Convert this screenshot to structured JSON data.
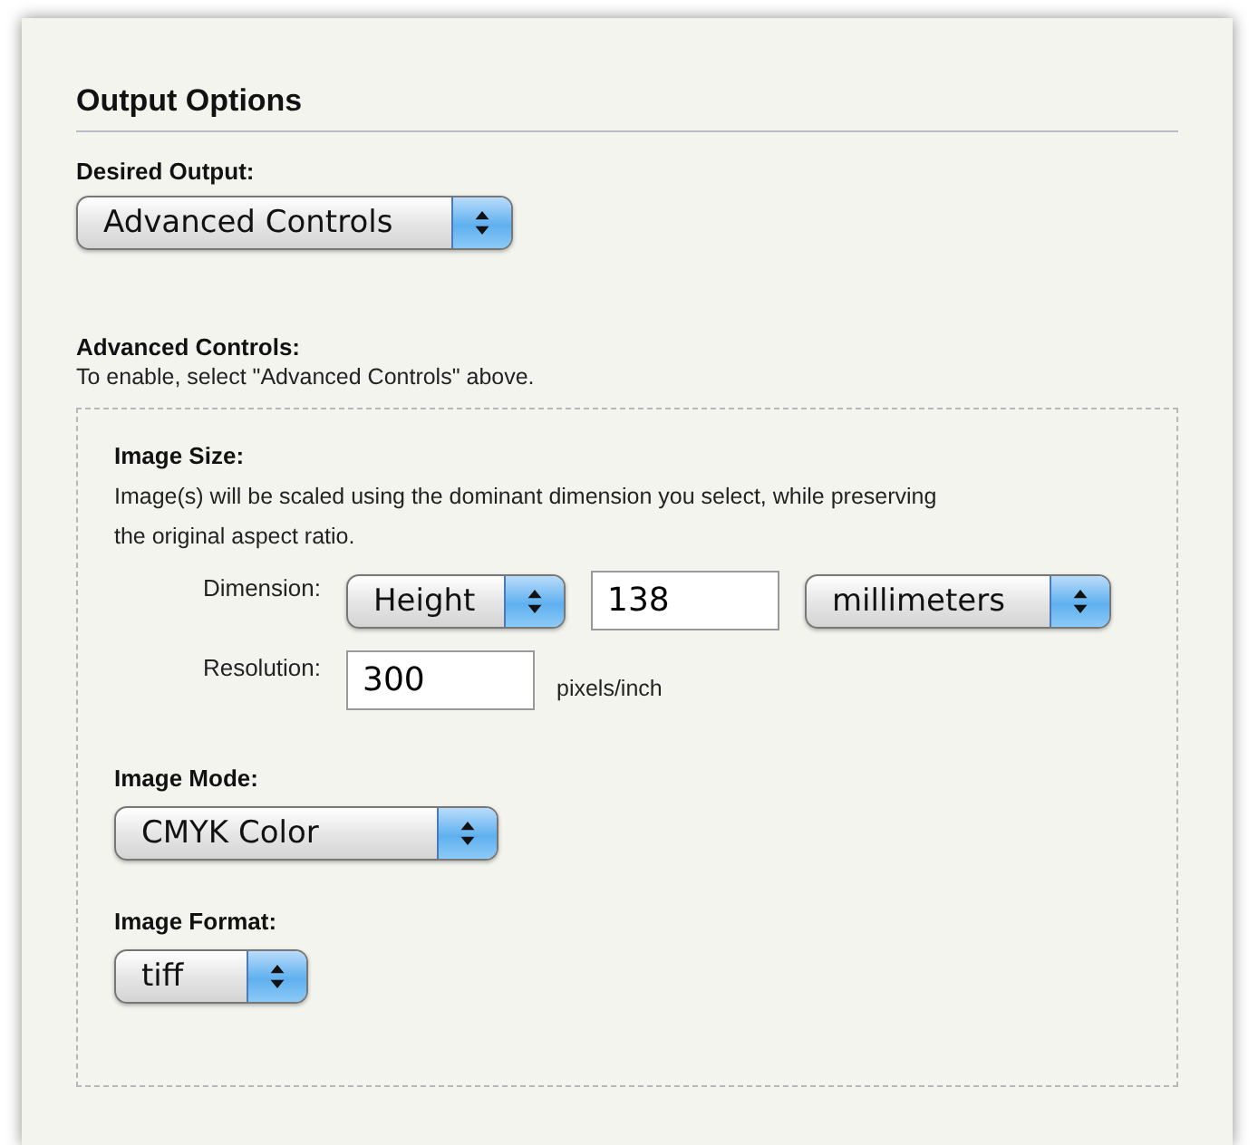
{
  "section_title": "Output Options",
  "desired_output": {
    "label": "Desired Output:",
    "value": "Advanced Controls"
  },
  "advanced": {
    "label": "Advanced Controls:",
    "hint": "To enable, select \"Advanced Controls\" above.",
    "image_size": {
      "label": "Image Size:",
      "description": "Image(s) will be scaled using the dominant dimension you select, while preserving the original aspect ratio.",
      "dimension": {
        "label": "Dimension:",
        "axis": "Height",
        "value": "138",
        "unit": "millimeters"
      },
      "resolution": {
        "label": "Resolution:",
        "value": "300",
        "unit": "pixels/inch"
      }
    },
    "image_mode": {
      "label": "Image Mode:",
      "value": "CMYK Color"
    },
    "image_format": {
      "label": "Image Format:",
      "value": "tiff"
    }
  }
}
